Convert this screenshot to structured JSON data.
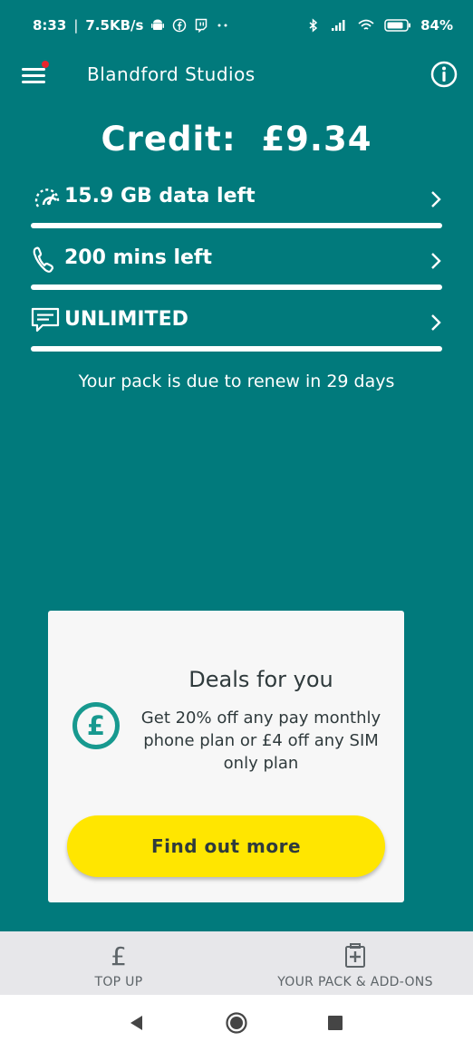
{
  "status_bar": {
    "time": "8:33",
    "network_speed": "7.5KB/s",
    "left_icons": [
      "android-icon",
      "facebook-icon",
      "twitch-icon",
      "more-dots-icon"
    ],
    "right_icons": [
      "bluetooth-icon",
      "signal-icon",
      "wifi-icon",
      "battery-icon"
    ],
    "battery_text": "84"
  },
  "header": {
    "title": "Blandford Studios",
    "menu_icon": "hamburger-menu-icon",
    "info_icon": "info-icon"
  },
  "credit": {
    "label": "Credit:",
    "amount": "£9.34"
  },
  "allowances": [
    {
      "icon": "speedometer-icon",
      "label": "15.9 GB data left",
      "remaining_fraction": 1.0
    },
    {
      "icon": "phone-icon",
      "label": "200 mins left",
      "remaining_fraction": 1.0
    },
    {
      "icon": "message-icon",
      "label": "UNLIMITED",
      "remaining_fraction": 1.0
    }
  ],
  "renew_text": "Your pack is due to renew in 29 days",
  "deals": {
    "title": "Deals for you",
    "body": "Get 20% off any pay monthly phone plan or £4 off any SIM only plan",
    "button_label": "Find out more",
    "icon": "pound-coin-icon"
  },
  "bottom_nav": {
    "items": [
      {
        "label": "TOP UP",
        "icon": "pound-icon"
      },
      {
        "label": "YOUR PACK & ADD-ONS",
        "icon": "sim-pack-icon"
      }
    ]
  },
  "system_nav": {
    "icons": [
      "back-icon",
      "home-icon",
      "recents-icon"
    ]
  },
  "colors": {
    "background": "#017A7C",
    "card": "#F7F7F7",
    "button": "#FFE600",
    "accent_teal": "#17998F",
    "notification_dot": "#E8262D"
  }
}
